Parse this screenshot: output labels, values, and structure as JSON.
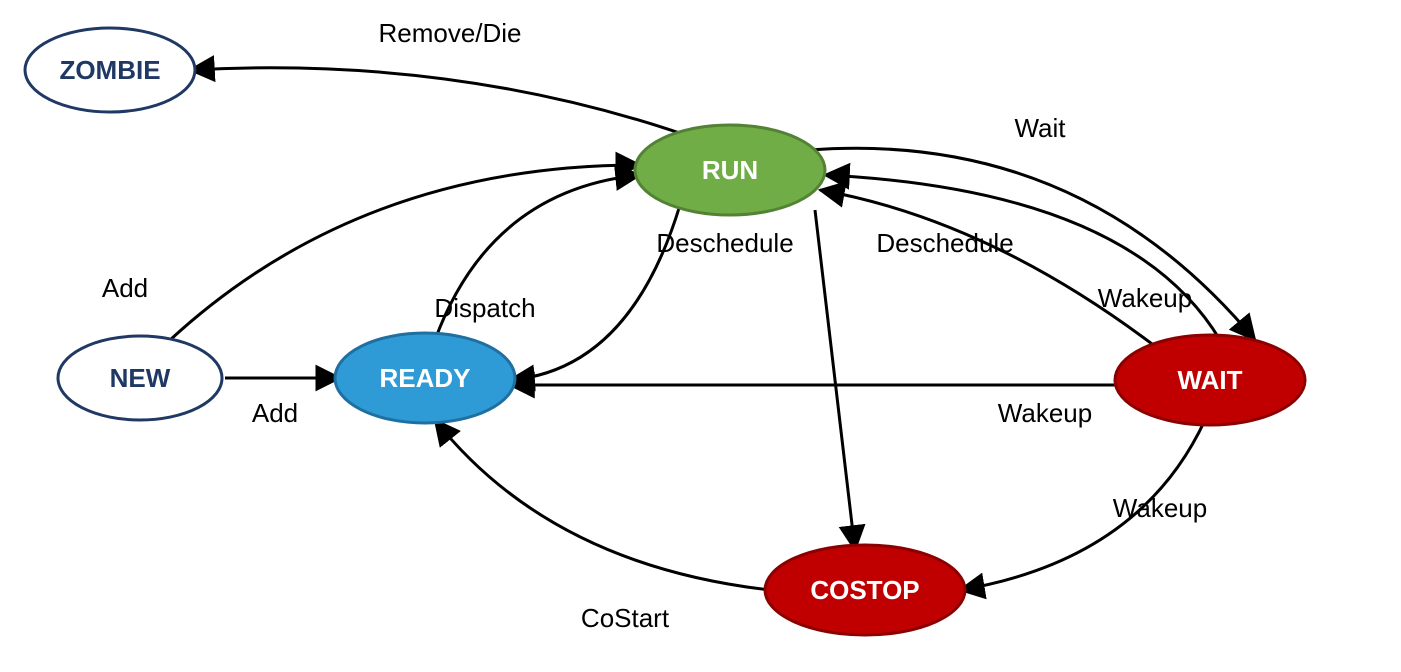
{
  "states": {
    "zombie": {
      "label": "ZOMBIE",
      "fill": "#ffffff",
      "stroke": "#1f3864",
      "text": "#1f3864"
    },
    "new": {
      "label": "NEW",
      "fill": "#ffffff",
      "stroke": "#1f3864",
      "text": "#1f3864"
    },
    "run": {
      "label": "RUN",
      "fill": "#70ad47",
      "stroke": "#548235",
      "text": "#ffffff"
    },
    "ready": {
      "label": "READY",
      "fill": "#2e9bd6",
      "stroke": "#1f6fa1",
      "text": "#ffffff"
    },
    "wait": {
      "label": "WAIT",
      "fill": "#c00000",
      "stroke": "#8b0000",
      "text": "#ffffff"
    },
    "costop": {
      "label": "COSTOP",
      "fill": "#c00000",
      "stroke": "#8b0000",
      "text": "#ffffff"
    }
  },
  "transitions": {
    "run_to_zombie": {
      "label": "Remove/Die"
    },
    "new_to_run": {
      "label": "Add"
    },
    "new_to_ready": {
      "label": "Add"
    },
    "ready_to_run": {
      "label": "Dispatch"
    },
    "run_to_ready": {
      "label": "Deschedule"
    },
    "run_to_wait": {
      "label": "Wait"
    },
    "wait_to_run": {
      "label": "Deschedule"
    },
    "wait_to_run_b": {
      "label": "Wakeup"
    },
    "wait_to_ready": {
      "label": "Wakeup"
    },
    "wait_to_costop": {
      "label": "Wakeup"
    },
    "run_to_costop": {
      "label": ""
    },
    "costop_to_ready": {
      "label": "CoStart"
    }
  }
}
